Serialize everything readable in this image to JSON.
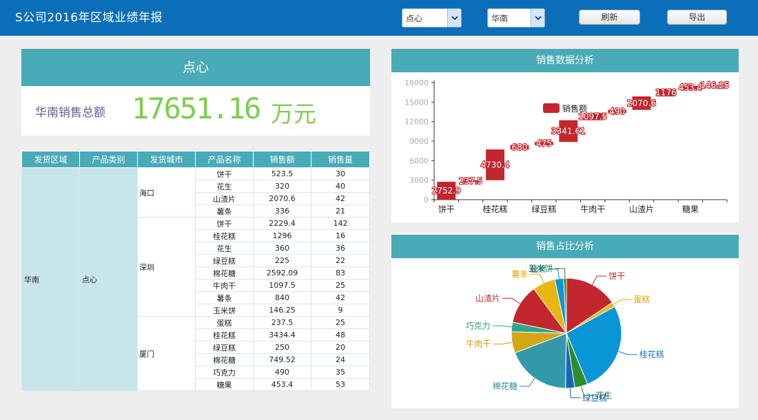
{
  "header": {
    "title": "S公司2016年区域业绩年报",
    "product_select": "点心",
    "region_select": "华南",
    "refresh_label": "刷新",
    "export_label": "导出"
  },
  "kpi": {
    "title": "点心",
    "label": "华南销售总额",
    "value": "17651.16",
    "unit": "万元"
  },
  "table": {
    "headers": [
      "发货区域",
      "产品类别",
      "发货城市",
      "产品名称",
      "销售额",
      "销售量"
    ],
    "region": "华南",
    "category": "点心",
    "groups": [
      {
        "city": "海口",
        "rows": [
          [
            "饼干",
            "523.5",
            "30"
          ],
          [
            "花生",
            "320",
            "40"
          ],
          [
            "山渣片",
            "2070.6",
            "42"
          ],
          [
            "薯条",
            "336",
            "21"
          ]
        ]
      },
      {
        "city": "深圳",
        "rows": [
          [
            "饼干",
            "2229.4",
            "142"
          ],
          [
            "桂花糕",
            "1296",
            "16"
          ],
          [
            "花生",
            "360",
            "36"
          ],
          [
            "绿豆糕",
            "225",
            "22"
          ],
          [
            "棉花糖",
            "2592.09",
            "83"
          ],
          [
            "牛肉干",
            "1097.5",
            "25"
          ],
          [
            "薯条",
            "840",
            "42"
          ],
          [
            "玉米饼",
            "146.25",
            "9"
          ]
        ]
      },
      {
        "city": "厦门",
        "rows": [
          [
            "蛋糕",
            "237.5",
            "25"
          ],
          [
            "桂花糕",
            "3434.4",
            "48"
          ],
          [
            "绿豆糕",
            "250",
            "20"
          ],
          [
            "棉花糖",
            "749.52",
            "24"
          ],
          [
            "巧克力",
            "490",
            "35"
          ],
          [
            "糖果",
            "453.4",
            "53"
          ]
        ]
      }
    ]
  },
  "waterfall": {
    "panel_title": "销售数据分析"
  },
  "pie": {
    "panel_title": "销售占比分析"
  },
  "chart_data": [
    {
      "type": "bar",
      "subtype": "waterfall",
      "title": "销售数据分析",
      "legend": "销售额",
      "legend_position": "top",
      "categories": [
        "饼干",
        "蛋糕",
        "桂花糕",
        "花生",
        "绿豆糕",
        "棉花糖",
        "牛肉干",
        "巧克力",
        "山渣片",
        "薯条",
        "糖果",
        "玉米饼"
      ],
      "x_tick_labels": [
        "饼干",
        "桂花糕",
        "绿豆糕",
        "牛肉干",
        "山渣片",
        "糖果"
      ],
      "values": [
        2752.9,
        237.5,
        4730.4,
        680,
        475,
        3341.61,
        1097.5,
        490,
        2070.6,
        1176,
        453.4,
        146.25
      ],
      "labels": [
        "2752.9",
        "237.5",
        "4730.4",
        "680",
        "475",
        "3341.61",
        "1097.5",
        "490",
        "2070.6",
        "1176",
        "453.4",
        "146.25"
      ],
      "ylim": [
        0,
        18000
      ],
      "yticks": [
        0,
        3000,
        6000,
        9000,
        12000,
        15000,
        18000
      ],
      "color": "#c1272d",
      "grid": false
    },
    {
      "type": "pie",
      "title": "销售占比分析",
      "categories": [
        "饼干",
        "蛋糕",
        "桂花糕",
        "花生",
        "绿豆糕",
        "棉花糖",
        "牛肉干",
        "巧克力",
        "山渣片",
        "薯条",
        "糖果",
        "玉米饼"
      ],
      "values": [
        2752.9,
        237.5,
        4730.4,
        680,
        475,
        3341.61,
        1097.5,
        490,
        2070.6,
        1176,
        453.4,
        146.25
      ],
      "colors": [
        "#c1272d",
        "#e8b612",
        "#0a96d6",
        "#2e8b2e",
        "#1766b5",
        "#3399aa",
        "#d4a516",
        "#2fa58c",
        "#c1272d",
        "#e8b612",
        "#0a96d6",
        "#2e8b2e"
      ],
      "label_colors": [
        "#c1272d",
        "#d9a70c",
        "#1a78b4",
        "#2e7d32",
        "#1a5fa8",
        "#2e8a99",
        "#cf9b0e",
        "#2a9a80",
        "#c1272d",
        "#d9a70c",
        "#1a78b4",
        "#2e7d32"
      ]
    }
  ]
}
